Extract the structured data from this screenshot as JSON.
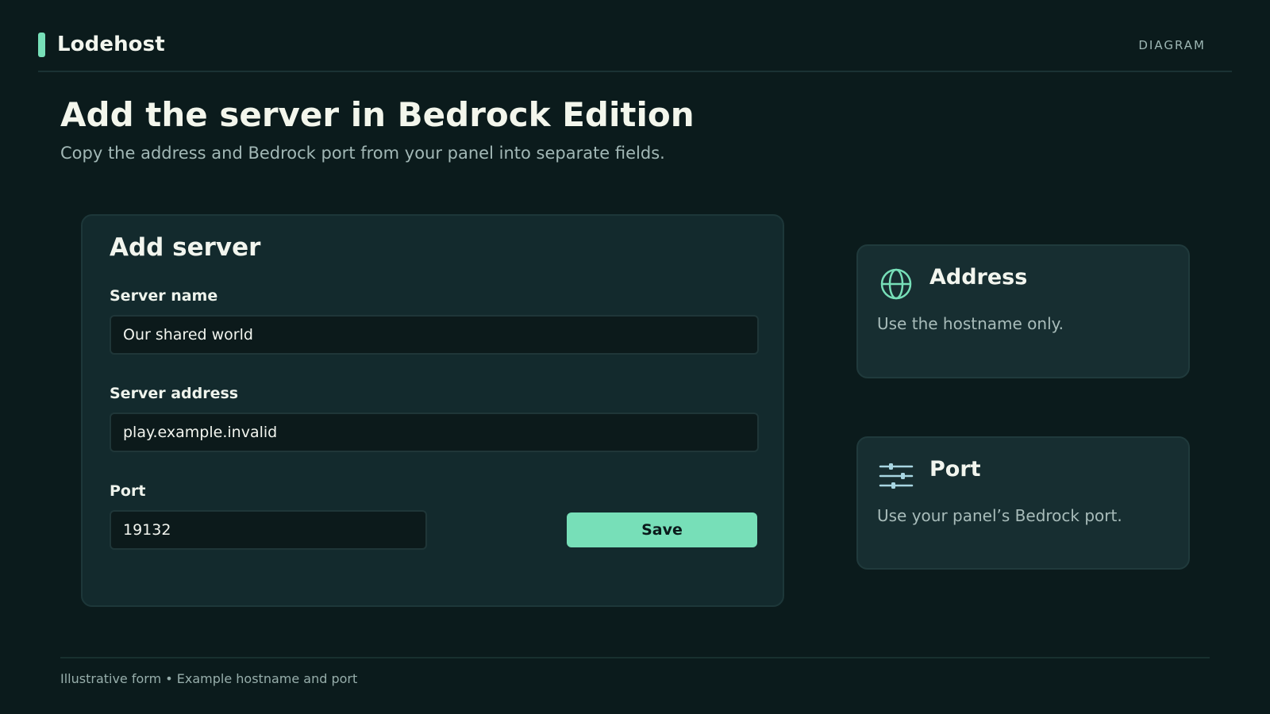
{
  "brand": {
    "name": "Lodehost",
    "tag": "DIAGRAM",
    "accent_color": "#77dfb8"
  },
  "page": {
    "title": "Add the server in Bedrock Edition",
    "subtitle": "Copy the address and Bedrock port from your panel into separate fields."
  },
  "form": {
    "title": "Add server",
    "fields": [
      {
        "label": "Server name",
        "value": "Our shared world"
      },
      {
        "label": "Server address",
        "value": "play.example.invalid"
      },
      {
        "label": "Port",
        "value": "19132"
      }
    ],
    "save_label": "Save",
    "save_color": "#77dfb8"
  },
  "info_cards": [
    {
      "icon": "globe-icon",
      "title": "Address",
      "text": "Use the hostname only."
    },
    {
      "icon": "sliders-icon",
      "title": "Port",
      "text": "Use your panel’s Bedrock port."
    }
  ],
  "footer": {
    "note": "Illustrative form • Example hostname and port"
  }
}
